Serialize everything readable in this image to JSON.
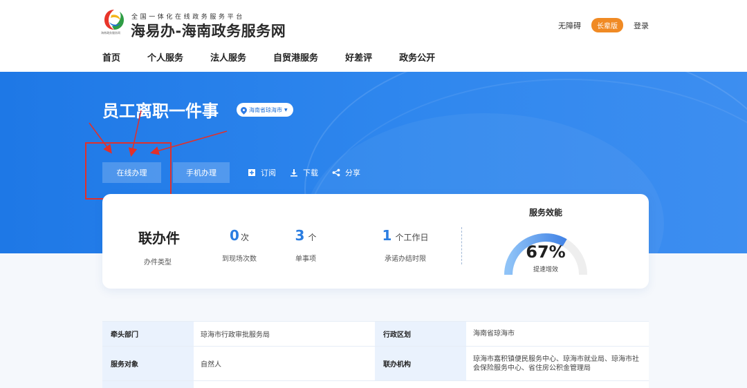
{
  "header": {
    "brand_sub": "全国一体化在线政务服务平台",
    "brand_title": "海易办-海南政务服务网",
    "logo_caption": "海南政务服务网",
    "accessibility": "无障碍",
    "elder_mode": "长辈版",
    "login": "登录"
  },
  "nav": [
    "首页",
    "个人服务",
    "法人服务",
    "自贸港服务",
    "好差评",
    "政务公开"
  ],
  "banner": {
    "title": "员工离职一件事",
    "region": "海南省琼海市",
    "btn_online": "在线办理",
    "btn_mobile": "手机办理",
    "subscribe": "订阅",
    "download": "下载",
    "share": "分享"
  },
  "stats": {
    "type_value": "联办件",
    "type_label": "办件类型",
    "visits_value": "0",
    "visits_unit": "次",
    "visits_label": "到现场次数",
    "items_value": "3",
    "items_unit": "个",
    "items_label": "单事项",
    "limit_value": "1",
    "limit_unit": "个工作日",
    "limit_label": "承诺办结时限"
  },
  "efficiency": {
    "title": "服务效能",
    "value": "67%",
    "fraction": 0.67,
    "label": "提速增效"
  },
  "info_table": {
    "row1": {
      "k1": "牵头部门",
      "v1": "琼海市行政审批服务局",
      "k2": "行政区划",
      "v2": "海南省琼海市"
    },
    "row2": {
      "k1": "服务对象",
      "v1": "自然人",
      "k2": "联办机构",
      "v2": "琼海市嘉积镇便民服务中心、琼海市就业局、琼海市社会保险服务中心、省住房公积金管理局"
    }
  },
  "colors": {
    "banner_blue": "#1e78e6",
    "accent_blue": "#2a7de1",
    "elder_orange": "#f08a24",
    "annotation_red": "#e1302a"
  }
}
